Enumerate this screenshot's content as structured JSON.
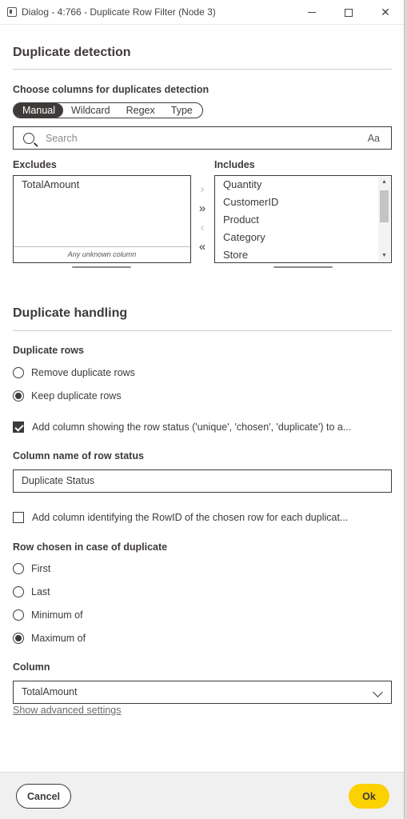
{
  "window": {
    "title": "Dialog - 4:766 - Duplicate Row Filter (Node 3)",
    "minimize": "—",
    "maximize": "□",
    "close": "✕"
  },
  "detection": {
    "section_title": "Duplicate detection",
    "choose_label": "Choose columns for duplicates detection",
    "modes": [
      "Manual",
      "Wildcard",
      "Regex",
      "Type"
    ],
    "active_mode": "Manual",
    "search_placeholder": "Search",
    "case_toggle": "Aa",
    "excludes_label": "Excludes",
    "includes_label": "Includes",
    "excludes": [
      "TotalAmount"
    ],
    "unknown_column": "Any unknown column",
    "includes": [
      "Quantity",
      "CustomerID",
      "Product",
      "Category",
      "Store"
    ],
    "move_right": "›",
    "move_all_right": "»",
    "move_left": "‹",
    "move_all_left": "«"
  },
  "handling": {
    "section_title": "Duplicate handling",
    "duplicate_rows_label": "Duplicate rows",
    "duplicate_rows_options": [
      "Remove duplicate rows",
      "Keep duplicate rows"
    ],
    "duplicate_rows_selected": "Keep duplicate rows",
    "add_status_label": "Add column showing the row status ('unique', 'chosen', 'duplicate') to a...",
    "add_status_checked": true,
    "status_name_label": "Column name of row status",
    "status_name_value": "Duplicate Status",
    "add_rowid_label": "Add column identifying the RowID of the chosen row for each duplicat...",
    "add_rowid_checked": false,
    "row_chosen_label": "Row chosen in case of duplicate",
    "row_chosen_options": [
      "First",
      "Last",
      "Minimum of",
      "Maximum of"
    ],
    "row_chosen_selected": "Maximum of",
    "column_label": "Column",
    "column_value": "TotalAmount",
    "advanced_link": "Show advanced settings"
  },
  "footer": {
    "cancel_label": "Cancel",
    "ok_label": "Ok",
    "ok_color": "#fcd100"
  }
}
